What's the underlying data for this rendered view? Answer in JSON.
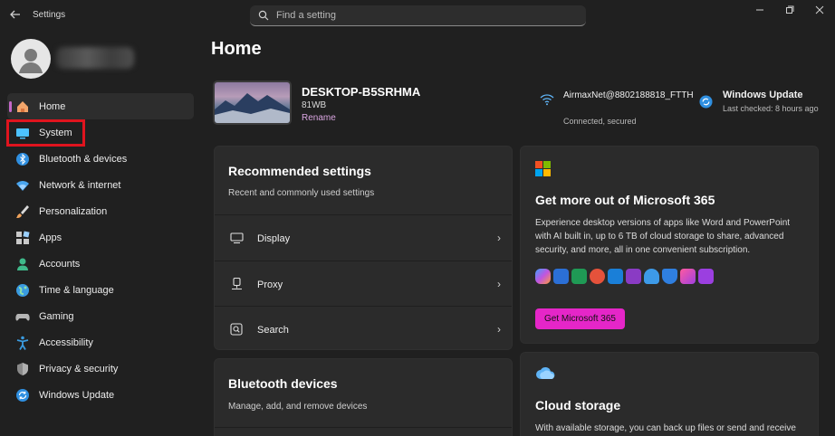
{
  "titlebar": {
    "app_title": "Settings",
    "search_placeholder": "Find a setting"
  },
  "sidebar": {
    "items": [
      {
        "label": "Home",
        "icon": "home-icon",
        "active": true
      },
      {
        "label": "System",
        "icon": "system-icon"
      },
      {
        "label": "Bluetooth & devices",
        "icon": "bluetooth-icon"
      },
      {
        "label": "Network & internet",
        "icon": "wifi-icon"
      },
      {
        "label": "Personalization",
        "icon": "brush-icon"
      },
      {
        "label": "Apps",
        "icon": "apps-icon"
      },
      {
        "label": "Accounts",
        "icon": "accounts-icon"
      },
      {
        "label": "Time & language",
        "icon": "globe-icon"
      },
      {
        "label": "Gaming",
        "icon": "gamepad-icon"
      },
      {
        "label": "Accessibility",
        "icon": "accessibility-icon"
      },
      {
        "label": "Privacy & security",
        "icon": "shield-icon"
      },
      {
        "label": "Windows Update",
        "icon": "update-icon"
      }
    ]
  },
  "main": {
    "title": "Home",
    "device": {
      "name": "DESKTOP-B5SRHMA",
      "model": "81WB",
      "rename": "Rename"
    },
    "network": {
      "name": "AirmaxNet@8802188818_FTTH",
      "status": "Connected, secured"
    },
    "update": {
      "title": "Windows Update",
      "subtitle": "Last checked: 8 hours ago"
    },
    "recommended": {
      "title": "Recommended settings",
      "subtitle": "Recent and commonly used settings",
      "rows": [
        {
          "label": "Display",
          "icon": "monitor-icon"
        },
        {
          "label": "Proxy",
          "icon": "proxy-icon"
        },
        {
          "label": "Search",
          "icon": "search-box-icon"
        }
      ]
    },
    "bluetooth": {
      "title": "Bluetooth devices",
      "subtitle": "Manage, add, and remove devices"
    },
    "m365": {
      "title": "Get more out of Microsoft 365",
      "description": "Experience desktop versions of apps like Word and PowerPoint with AI built in, up to 6 TB of cloud storage to share, advanced security, and more, all in one convenient subscription.",
      "button": "Get Microsoft 365"
    },
    "cloud": {
      "title": "Cloud storage",
      "description": "With available storage, you can back up files or send and receive"
    }
  },
  "colors": {
    "accent": "#c568c9",
    "button": "#e526c8",
    "highlight": "#e0141e"
  }
}
